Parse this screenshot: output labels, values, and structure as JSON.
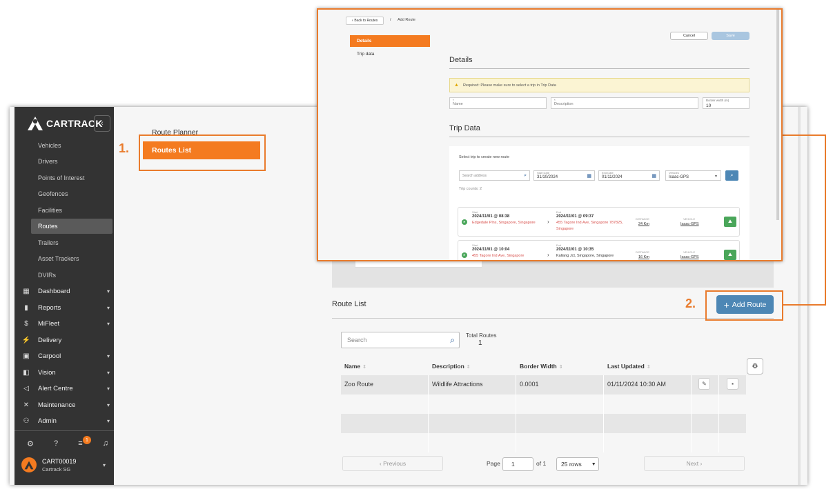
{
  "sidebar": {
    "logo_text": "CARTRACK",
    "sub_items": [
      "Vehicles",
      "Drivers",
      "Points of Interest",
      "Geofences",
      "Facilities",
      "Routes",
      "Trailers",
      "Asset Trackers",
      "DVIRs"
    ],
    "active_item": "Routes",
    "main_items": [
      {
        "label": "Dashboard",
        "icon": "dashboard-icon",
        "has_chevron": true
      },
      {
        "label": "Reports",
        "icon": "reports-icon",
        "has_chevron": true
      },
      {
        "label": "MiFleet",
        "icon": "dollar-icon",
        "has_chevron": true
      },
      {
        "label": "Delivery",
        "icon": "delivery-icon",
        "has_chevron": false
      },
      {
        "label": "Carpool",
        "icon": "calendar-icon",
        "has_chevron": true
      },
      {
        "label": "Vision",
        "icon": "camera-icon",
        "has_chevron": true
      },
      {
        "label": "Alert Centre",
        "icon": "megaphone-icon",
        "has_chevron": true
      },
      {
        "label": "Maintenance",
        "icon": "tools-icon",
        "has_chevron": true
      },
      {
        "label": "Admin",
        "icon": "admin-icon",
        "has_chevron": true
      }
    ],
    "notification_count": "1",
    "user": {
      "initials": "",
      "name": "CART00019",
      "org": "Cartrack SG"
    }
  },
  "planner": {
    "title": "Route Planner",
    "routes_list": "Routes List"
  },
  "callouts": {
    "one": "1.",
    "two": "2."
  },
  "route_list": {
    "title": "Route List",
    "add_button": "Add Route",
    "search_placeholder": "Search",
    "total_label": "Total Routes",
    "total_value": "1",
    "columns": [
      "Name",
      "Description",
      "Border Width",
      "Last Updated"
    ],
    "rows": [
      {
        "name": "Zoo Route",
        "description": "Wildlife Attractions",
        "border_width": "0.0001",
        "last_updated": "01/11/2024 10:30 AM"
      }
    ]
  },
  "pagination": {
    "previous": "Previous",
    "page_label": "Page",
    "page_value": "1",
    "of_label": "of 1",
    "rows_value": "25 rows",
    "next": "Next"
  },
  "overlay": {
    "back_label": "Back to Routes",
    "separator": "/",
    "crumb_current": "Add Route",
    "tab_details": "Details",
    "tab_trip_data": "Trip data",
    "cancel": "Cancel",
    "save": "Save",
    "details_heading": "Details",
    "warning": "Required: Please make sure to select a trip in Trip Data",
    "name_placeholder": "Name",
    "description_placeholder": "Description",
    "border_width_label": "Border width (m)",
    "border_width_value": "10",
    "trip_heading": "Trip Data",
    "trip_hint": "Select trip to create new route",
    "search_address": "Search address",
    "start_date_label": "Start Date",
    "start_date": "31/10/2024",
    "end_date_label": "End Date",
    "end_date": "01/11/2024",
    "vehicles_label": "Vehicles",
    "vehicles_value": "Isaac-GPS",
    "trip_counts": "Trip counts: 2",
    "trips": [
      {
        "start_label": "Start",
        "start": "2024/11/01 @ 08:38",
        "start_loc": "Edgedale Plns, Singapore, Singapore",
        "end_label": "End",
        "end": "2024/11/01 @ 09:37",
        "end_loc": "455 Tagore Ind Ave, Singapore 787825, Singapore",
        "distance_label": "DISTANCE",
        "distance": "24 Km",
        "vehicle_label": "VEHICLE",
        "vehicle": "Isaac-GPS"
      },
      {
        "start_label": "Start",
        "start": "2024/11/01 @ 10:04",
        "start_loc": "455 Tagore Ind Ave, Singapore",
        "end_label": "End",
        "end": "2024/11/01 @ 10:35",
        "end_loc": "Kallang Jct, Singapore, Singapore",
        "distance_label": "DISTANCE",
        "distance": "16 Km",
        "vehicle_label": "VEHICLE",
        "vehicle": "Isaac-GPS"
      }
    ]
  },
  "colors": {
    "accent": "#f47b20",
    "callout": "#e97b2c",
    "primary": "#4d87b5",
    "sidebar": "#333333",
    "success": "#4aa65a",
    "danger": "#d9534f"
  }
}
